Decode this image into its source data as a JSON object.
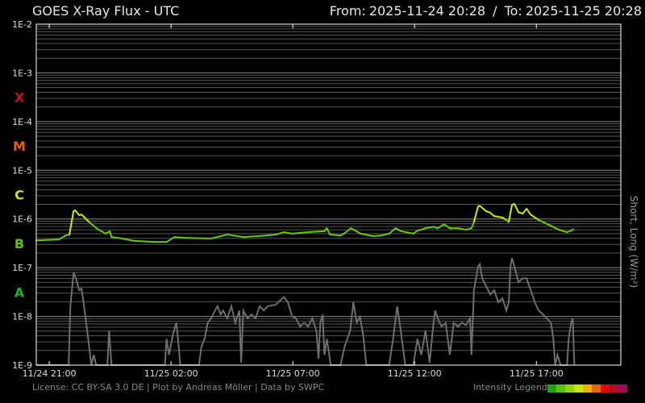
{
  "header": {
    "title": "GOES X-Ray Flux - UTC",
    "from_label": "From:",
    "from": "2025-11-24 20:28",
    "sep": "/",
    "to_label": "To:",
    "to": "2025-11-25 20:28"
  },
  "footer": {
    "credits": "License: CC BY-SA 3.0 DE | Plot by Andreas Möller | Data by SWPC",
    "legend_label": "Intensity Legend",
    "legend_colors": [
      "#1aa80a",
      "#5cc10a",
      "#8cd50a",
      "#c8e60a",
      "#f0b400",
      "#e8640a",
      "#e00a0a",
      "#b40a28",
      "#a00a5a"
    ]
  },
  "chart_data": {
    "type": "line",
    "title": "GOES X-Ray Flux - UTC",
    "ylabel": "Short, Long (W/m²)",
    "yscale": "log10",
    "ylim_log10": [
      -9,
      -2
    ],
    "y_ticks": [
      "1E-2",
      "1E-3",
      "1E-4",
      "1E-5",
      "1E-6",
      "1E-7",
      "1E-8",
      "1E-9"
    ],
    "x_unit": "hours since 2025-11-24 20:28 UTC",
    "xlim": [
      0,
      24
    ],
    "x_ticks": [
      {
        "t": 0.533,
        "label": "11/24 21:00"
      },
      {
        "t": 5.533,
        "label": "11/25 02:00"
      },
      {
        "t": 10.533,
        "label": "11/25 07:00"
      },
      {
        "t": 15.533,
        "label": "11/25 12:00"
      },
      {
        "t": 20.533,
        "label": "11/25 17:00"
      }
    ],
    "flare_classes": [
      {
        "label": "X",
        "color": "#c0102a",
        "log10": -3.5
      },
      {
        "label": "M",
        "color": "#e8600a",
        "log10": -4.5
      },
      {
        "label": "C",
        "color": "#d0e000",
        "log10": -5.5
      },
      {
        "label": "B",
        "color": "#66c000",
        "log10": -6.5
      },
      {
        "label": "A",
        "color": "#20b020",
        "log10": -7.5
      }
    ],
    "grid": true,
    "series": [
      {
        "name": "Long",
        "color_low": "#66cc00",
        "color_high": "#ccee00",
        "points": [
          [
            0,
            -6.44
          ],
          [
            0.93,
            -6.42
          ],
          [
            1.2,
            -6.34
          ],
          [
            1.36,
            -6.32
          ],
          [
            1.53,
            -5.84
          ],
          [
            1.59,
            -5.82
          ],
          [
            1.76,
            -5.92
          ],
          [
            1.86,
            -5.91
          ],
          [
            2.19,
            -6.07
          ],
          [
            2.52,
            -6.21
          ],
          [
            2.86,
            -6.3
          ],
          [
            3.02,
            -6.25
          ],
          [
            3.09,
            -6.37
          ],
          [
            3.52,
            -6.4
          ],
          [
            4.02,
            -6.45
          ],
          [
            4.85,
            -6.47
          ],
          [
            5.35,
            -6.47
          ],
          [
            5.68,
            -6.37
          ],
          [
            6.18,
            -6.39
          ],
          [
            7.18,
            -6.4
          ],
          [
            7.84,
            -6.32
          ],
          [
            8.5,
            -6.37
          ],
          [
            9.17,
            -6.35
          ],
          [
            9.83,
            -6.32
          ],
          [
            10.17,
            -6.27
          ],
          [
            10.5,
            -6.3
          ],
          [
            11.16,
            -6.27
          ],
          [
            11.83,
            -6.25
          ],
          [
            11.93,
            -6.19
          ],
          [
            12.06,
            -6.32
          ],
          [
            12.49,
            -6.34
          ],
          [
            12.66,
            -6.29
          ],
          [
            12.92,
            -6.19
          ],
          [
            13.32,
            -6.3
          ],
          [
            13.82,
            -6.35
          ],
          [
            14.15,
            -6.34
          ],
          [
            14.49,
            -6.3
          ],
          [
            14.75,
            -6.19
          ],
          [
            14.98,
            -6.25
          ],
          [
            15.48,
            -6.3
          ],
          [
            15.65,
            -6.24
          ],
          [
            15.98,
            -6.19
          ],
          [
            16.31,
            -6.16
          ],
          [
            16.48,
            -6.19
          ],
          [
            16.64,
            -6.14
          ],
          [
            16.74,
            -6.11
          ],
          [
            16.98,
            -6.19
          ],
          [
            17.31,
            -6.19
          ],
          [
            17.64,
            -6.22
          ],
          [
            17.87,
            -6.19
          ],
          [
            17.97,
            -6.06
          ],
          [
            18.14,
            -5.74
          ],
          [
            18.21,
            -5.73
          ],
          [
            18.47,
            -5.84
          ],
          [
            18.64,
            -5.87
          ],
          [
            18.8,
            -5.94
          ],
          [
            19.14,
            -5.97
          ],
          [
            19.3,
            -6.02
          ],
          [
            19.4,
            -6.06
          ],
          [
            19.53,
            -5.71
          ],
          [
            19.63,
            -5.69
          ],
          [
            19.8,
            -5.86
          ],
          [
            19.97,
            -5.89
          ],
          [
            20.13,
            -5.79
          ],
          [
            20.3,
            -5.91
          ],
          [
            20.63,
            -6.02
          ],
          [
            21.13,
            -6.14
          ],
          [
            21.46,
            -6.22
          ],
          [
            21.79,
            -6.27
          ],
          [
            21.96,
            -6.24
          ],
          [
            22.06,
            -6.21
          ]
        ]
      },
      {
        "name": "Short",
        "color": "#6e6e6e",
        "points": [
          [
            0,
            -9
          ],
          [
            1.33,
            -9
          ],
          [
            1.4,
            -7.79
          ],
          [
            1.53,
            -7.1
          ],
          [
            1.63,
            -7.22
          ],
          [
            1.76,
            -7.46
          ],
          [
            1.86,
            -7.43
          ],
          [
            1.96,
            -7.79
          ],
          [
            2.13,
            -8.46
          ],
          [
            2.26,
            -9
          ],
          [
            2.36,
            -8.79
          ],
          [
            2.46,
            -9
          ],
          [
            2.92,
            -9
          ],
          [
            2.99,
            -8.29
          ],
          [
            3.09,
            -9
          ],
          [
            5.28,
            -9
          ],
          [
            5.35,
            -8.46
          ],
          [
            5.45,
            -8.79
          ],
          [
            5.61,
            -8.37
          ],
          [
            5.75,
            -8.13
          ],
          [
            5.85,
            -8.62
          ],
          [
            5.91,
            -9
          ],
          [
            6.68,
            -9
          ],
          [
            6.78,
            -8.62
          ],
          [
            6.91,
            -8.46
          ],
          [
            7.04,
            -8.13
          ],
          [
            7.18,
            -8.04
          ],
          [
            7.34,
            -7.88
          ],
          [
            7.44,
            -7.79
          ],
          [
            7.57,
            -7.96
          ],
          [
            7.67,
            -7.88
          ],
          [
            7.84,
            -8.04
          ],
          [
            8.01,
            -7.79
          ],
          [
            8.17,
            -8.13
          ],
          [
            8.34,
            -7.88
          ],
          [
            8.41,
            -8.95
          ],
          [
            8.5,
            -7.88
          ],
          [
            8.67,
            -8.04
          ],
          [
            8.84,
            -7.96
          ],
          [
            9.0,
            -8.04
          ],
          [
            9.17,
            -7.79
          ],
          [
            9.34,
            -7.88
          ],
          [
            9.5,
            -7.79
          ],
          [
            9.83,
            -7.76
          ],
          [
            10.17,
            -7.6
          ],
          [
            10.33,
            -7.71
          ],
          [
            10.5,
            -7.99
          ],
          [
            10.66,
            -8.04
          ],
          [
            10.83,
            -8.21
          ],
          [
            11.0,
            -8.13
          ],
          [
            11.16,
            -8.21
          ],
          [
            11.33,
            -8.04
          ],
          [
            11.5,
            -8.29
          ],
          [
            11.59,
            -8.87
          ],
          [
            11.66,
            -8.13
          ],
          [
            11.76,
            -7.96
          ],
          [
            11.83,
            -8.79
          ],
          [
            11.93,
            -8.46
          ],
          [
            12.09,
            -9
          ],
          [
            12.49,
            -9
          ],
          [
            12.66,
            -8.62
          ],
          [
            12.89,
            -8.29
          ],
          [
            13.02,
            -7.71
          ],
          [
            13.16,
            -8.13
          ],
          [
            13.29,
            -8.01
          ],
          [
            13.42,
            -8.37
          ],
          [
            13.55,
            -9
          ],
          [
            14.49,
            -9
          ],
          [
            14.65,
            -8.46
          ],
          [
            14.82,
            -7.79
          ],
          [
            14.92,
            -8.13
          ],
          [
            15.05,
            -8.62
          ],
          [
            15.15,
            -9
          ],
          [
            15.48,
            -9
          ],
          [
            15.65,
            -8.46
          ],
          [
            15.81,
            -8.79
          ],
          [
            15.98,
            -8.29
          ],
          [
            16.15,
            -8.95
          ],
          [
            16.31,
            -8.13
          ],
          [
            16.38,
            -7.88
          ],
          [
            16.48,
            -8.04
          ],
          [
            16.64,
            -8.21
          ],
          [
            16.81,
            -8.13
          ],
          [
            16.98,
            -8.79
          ],
          [
            17.14,
            -8.13
          ],
          [
            17.31,
            -8.21
          ],
          [
            17.48,
            -8.13
          ],
          [
            17.64,
            -8.18
          ],
          [
            17.81,
            -8.04
          ],
          [
            17.87,
            -8.79
          ],
          [
            17.97,
            -7.46
          ],
          [
            18.14,
            -6.97
          ],
          [
            18.21,
            -6.93
          ],
          [
            18.31,
            -7.22
          ],
          [
            18.47,
            -7.38
          ],
          [
            18.64,
            -7.55
          ],
          [
            18.8,
            -7.46
          ],
          [
            18.97,
            -7.71
          ],
          [
            19.14,
            -7.63
          ],
          [
            19.3,
            -7.88
          ],
          [
            19.4,
            -7.71
          ],
          [
            19.47,
            -6.97
          ],
          [
            19.53,
            -6.8
          ],
          [
            19.63,
            -6.97
          ],
          [
            19.8,
            -7.3
          ],
          [
            19.97,
            -7.22
          ],
          [
            20.13,
            -7.22
          ],
          [
            20.3,
            -7.46
          ],
          [
            20.47,
            -7.71
          ],
          [
            20.63,
            -7.88
          ],
          [
            20.8,
            -7.96
          ],
          [
            20.96,
            -8.04
          ],
          [
            21.13,
            -8.13
          ],
          [
            21.23,
            -8.46
          ],
          [
            21.3,
            -9
          ],
          [
            21.4,
            -8.79
          ],
          [
            21.53,
            -9
          ],
          [
            21.79,
            -9
          ],
          [
            21.86,
            -8.46
          ],
          [
            21.96,
            -8.13
          ],
          [
            22.03,
            -8.04
          ],
          [
            22.09,
            -9
          ]
        ]
      }
    ]
  }
}
